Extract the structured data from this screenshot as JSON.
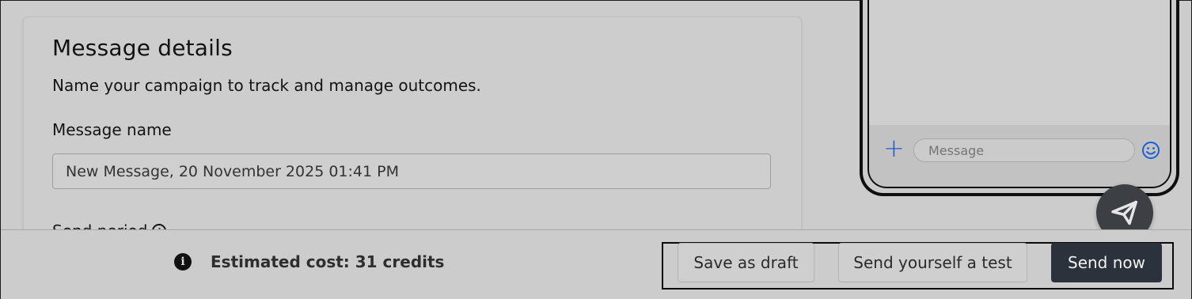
{
  "message_details": {
    "title": "Message details",
    "subtitle": "Name your campaign to track and manage outcomes.",
    "name_label": "Message name",
    "name_value": "New Message, 20 November 2025 01:41 PM",
    "send_period_label": "Send period"
  },
  "phone_preview": {
    "message_placeholder": "Message",
    "plus_icon": "plus-icon",
    "emoji_icon": "smiley-icon"
  },
  "fab": {
    "icon": "paper-plane-icon"
  },
  "footer": {
    "estimated_cost": "Estimated cost: 31 credits",
    "save_draft_label": "Save as draft",
    "send_test_label": "Send yourself a test",
    "send_now_label": "Send now"
  },
  "colors": {
    "primary_button": "#2c323b",
    "accent_blue": "#1a5fd6",
    "background": "#cccccc"
  }
}
